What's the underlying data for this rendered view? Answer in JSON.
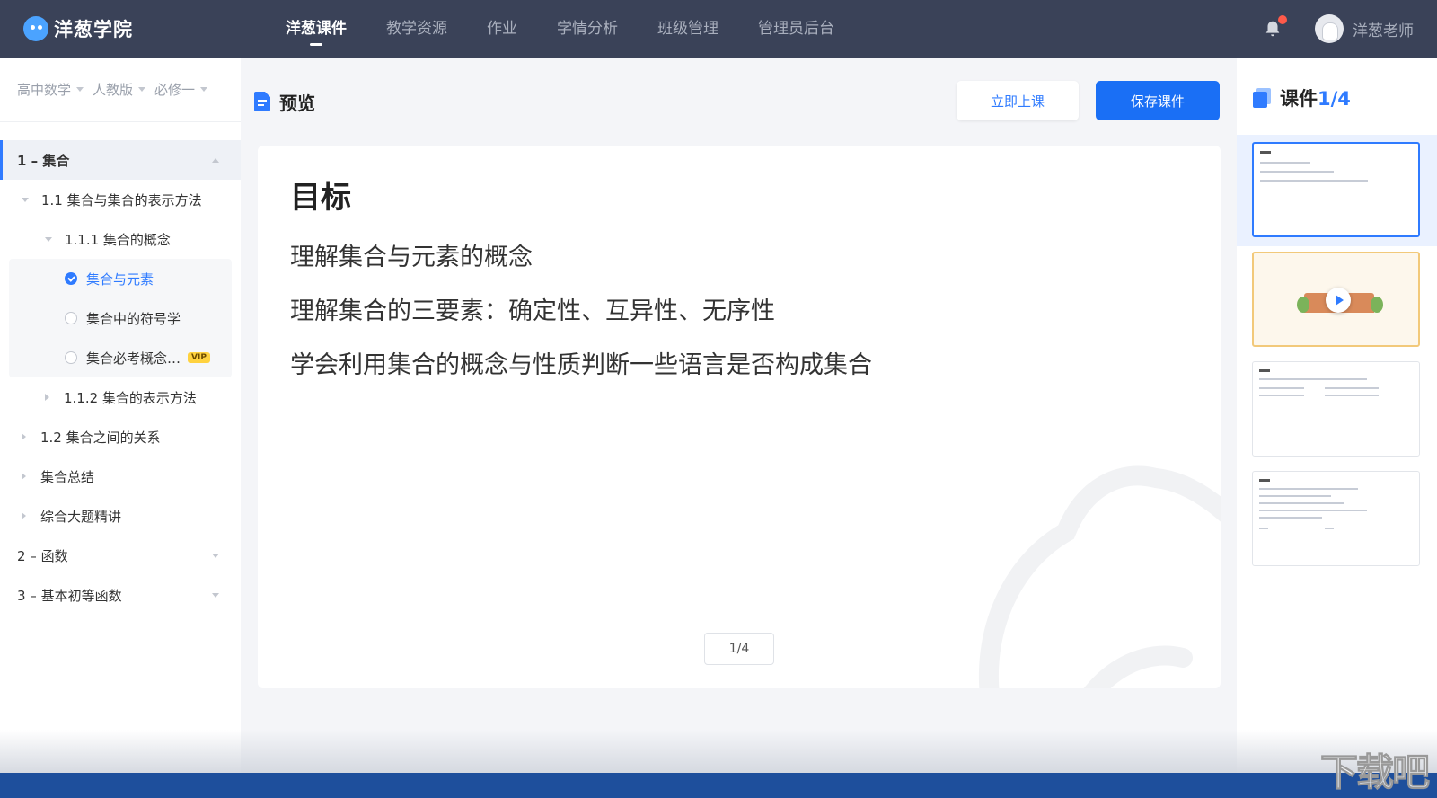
{
  "app": {
    "logo_text": "洋葱学院"
  },
  "nav": {
    "items": [
      {
        "label": "洋葱课件"
      },
      {
        "label": "教学资源"
      },
      {
        "label": "作业"
      },
      {
        "label": "学情分析"
      },
      {
        "label": "班级管理"
      },
      {
        "label": "管理员后台"
      }
    ],
    "active_index": 0
  },
  "user": {
    "name": "洋葱老师"
  },
  "sidebar": {
    "crumbs": [
      {
        "label": "高中数学"
      },
      {
        "label": "人教版"
      },
      {
        "label": "必修一"
      }
    ],
    "tree": {
      "ch1": "1 – 集合",
      "s1_1": "1.1 集合与集合的表示方法",
      "s1_1_1": "1.1.1 集合的概念",
      "leaf1": "集合与元素",
      "leaf2": "集合中的符号学",
      "leaf3": "集合必考概念…",
      "vip": "VIP",
      "s1_1_2": "1.1.2 集合的表示方法",
      "s1_2": "1.2 集合之间的关系",
      "s_summary": "集合总结",
      "s_review": "综合大题精讲",
      "ch2": "2 – 函数",
      "ch3": "3 – 基本初等函数"
    }
  },
  "preview": {
    "title": "预览",
    "start_class_label": "立即上课",
    "save_label": "保存课件"
  },
  "slide": {
    "title": "目标",
    "lines": [
      "理解集合与元素的概念",
      "理解集合的三要素：确定性、互异性、无序性",
      "学会利用集合的概念与性质判断一些语言是否构成集合"
    ],
    "pager": "1/4"
  },
  "right_panel": {
    "title_prefix": "课件",
    "title_count": "1/4"
  },
  "watermark": {
    "site_text": "下载吧"
  },
  "colors": {
    "accent": "#2f7bff",
    "nav_bg": "#3a4258",
    "save_button": "#1a6ff5"
  }
}
